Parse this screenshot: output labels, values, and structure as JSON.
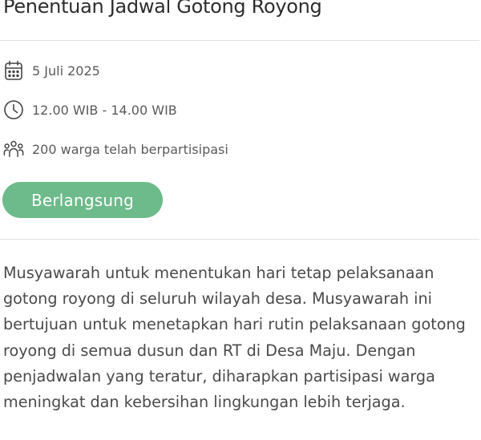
{
  "event": {
    "title": "Penentuan Jadwal Gotong Royong",
    "date": "5 Juli 2025",
    "time": "12.00 WIB - 14.00 WIB",
    "participants": "200 warga telah berpartisipasi",
    "status": "Berlangsung",
    "description": "Musyawarah untuk menentukan hari tetap pelaksanaan gotong royong di seluruh wilayah desa. Musyawarah ini bertujuan untuk menetapkan hari rutin pelaksanaan gotong royong di semua dusun dan RT di Desa Maju. Dengan penjadwalan yang teratur, diharapkan partisipasi warga meningkat dan kebersihan lingkungan lebih terjaga."
  },
  "icons": {
    "date": "calendar-icon",
    "time": "clock-icon",
    "participants": "people-group-icon"
  },
  "colors": {
    "status_badge": "#6dbb8a",
    "text_primary": "#2d2d2d",
    "text_secondary": "#5a5a5a",
    "divider": "#e3e3e3"
  }
}
